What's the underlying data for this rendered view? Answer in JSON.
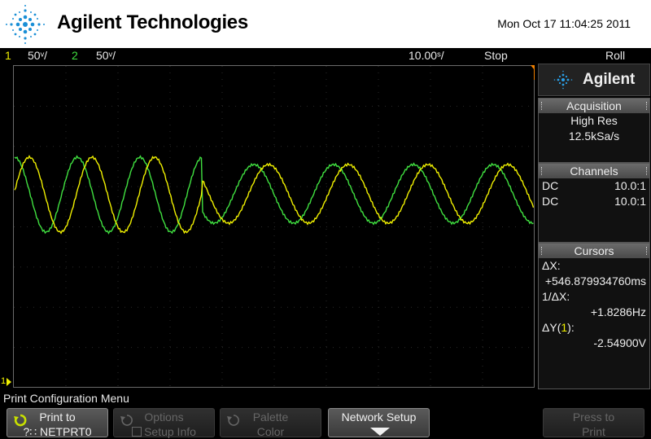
{
  "header": {
    "brand": "Agilent Technologies",
    "datetime": "Mon Oct 17 11:04:25 2011"
  },
  "statusbar": {
    "ch1_number": "1",
    "ch1_scale": "50ᵛ/",
    "ch2_number": "2",
    "ch2_scale": "50ᵛ/",
    "timebase": "10.00ˢ/",
    "run_state": "Stop",
    "mode": "Roll"
  },
  "panel": {
    "logo_text": "Agilent",
    "acquisition": {
      "title": "Acquisition",
      "mode": "High Res",
      "rate": "12.5kSa/s"
    },
    "channels": {
      "title": "Channels",
      "rows": [
        {
          "coupling": "DC",
          "probe": "10.0:1",
          "color": "#f0f000"
        },
        {
          "coupling": "DC",
          "probe": "10.0:1",
          "color": "#40e040"
        }
      ]
    },
    "cursors": {
      "title": "Cursors",
      "dx_label": "ΔX:",
      "dx_value": "+546.879934760ms",
      "inv_dx_label": "1/ΔX:",
      "inv_dx_value": "+1.8286Hz",
      "dy_label_prefix": "ΔY(",
      "dy_label_channel": "1",
      "dy_label_suffix": "):",
      "dy_value": "-2.54900V"
    }
  },
  "menu": {
    "title": "Print Configuration Menu",
    "softkeys": [
      {
        "line1": "Print to",
        "line2": "?∷ NETPRT0",
        "enabled": true
      },
      {
        "line1": "Options",
        "line2": "Setup Info",
        "enabled": false
      },
      {
        "line1": "Palette",
        "line2": "Color",
        "enabled": false
      },
      {
        "line1": "Network Setup",
        "line2": "",
        "enabled": true
      },
      {
        "line1": "Press to",
        "line2": "Print",
        "enabled": false
      }
    ]
  },
  "markers": {
    "ground_ref": "1"
  },
  "colors": {
    "ch1": "#f0f000",
    "ch2": "#40e040",
    "trigger_marker": "#f08000"
  }
}
